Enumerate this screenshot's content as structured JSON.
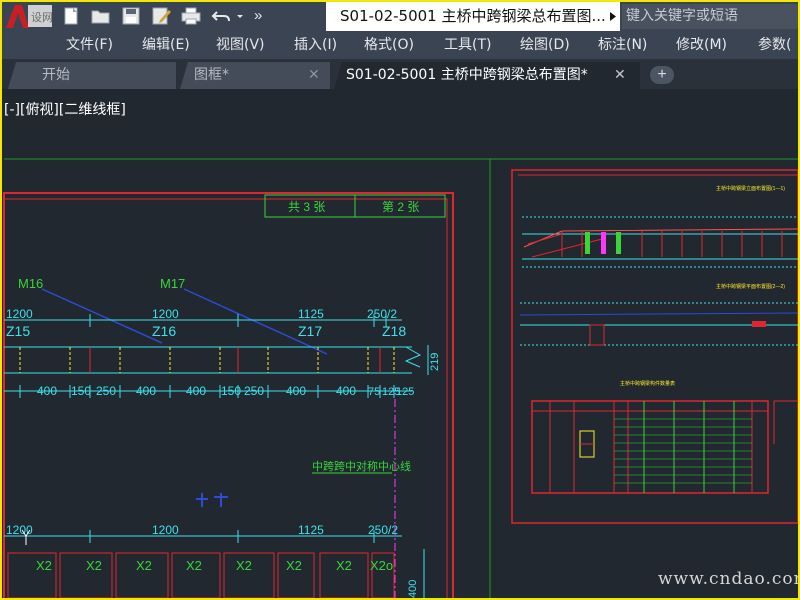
{
  "title_bar": {
    "document_title": "S01-02-5001 主桥中跨钢梁总布置图....",
    "search_placeholder": "键入关键字或短语",
    "more_glyph": "»"
  },
  "menu": {
    "items": [
      "文件(F)",
      "编辑(E)",
      "视图(V)",
      "插入(I)",
      "格式(O)",
      "工具(T)",
      "绘图(D)",
      "标注(N)",
      "修改(M)",
      "参数("
    ]
  },
  "tabs": {
    "items": [
      "开始",
      "图框*",
      "S01-02-5001 主桥中跨钢梁总布置图*"
    ],
    "close_glyph": "✕",
    "add_glyph": "+"
  },
  "viewport": {
    "label": "[-][俯视][二维线框]"
  },
  "drawing": {
    "title_block": {
      "total": "共 3 张",
      "sheet": "第 2 张"
    },
    "members_top": [
      "M16",
      "M17"
    ],
    "dims_top": [
      "1200",
      "1200",
      "1125",
      "250",
      "250/2"
    ],
    "sections": [
      "Z15",
      "Z16",
      "Z17",
      "Z18"
    ],
    "height_dim": "219",
    "dims_bottom": [
      "400",
      "150",
      "250",
      "400",
      "400",
      "150",
      "250",
      "400",
      "400",
      "75",
      "125",
      "125"
    ],
    "centerline_note": "中跨跨中对称中心线",
    "dims_lower": [
      "1200",
      "1200",
      "1125",
      "250/2"
    ],
    "x_labels": [
      "X2",
      "X2",
      "X2",
      "X2",
      "X2",
      "X2",
      "X2",
      "X2o"
    ],
    "vertical_dim": "400",
    "colors": {
      "background": "#212830",
      "frame_red": "#e0262e",
      "cyan": "#3fe0ea",
      "green": "#39d539",
      "yellow": "#ffec28",
      "blue": "#2a4cd6",
      "magenta": "#ff38ff",
      "title_yellow_border": "#f2e800"
    }
  },
  "watermark": "www.cndao.com"
}
